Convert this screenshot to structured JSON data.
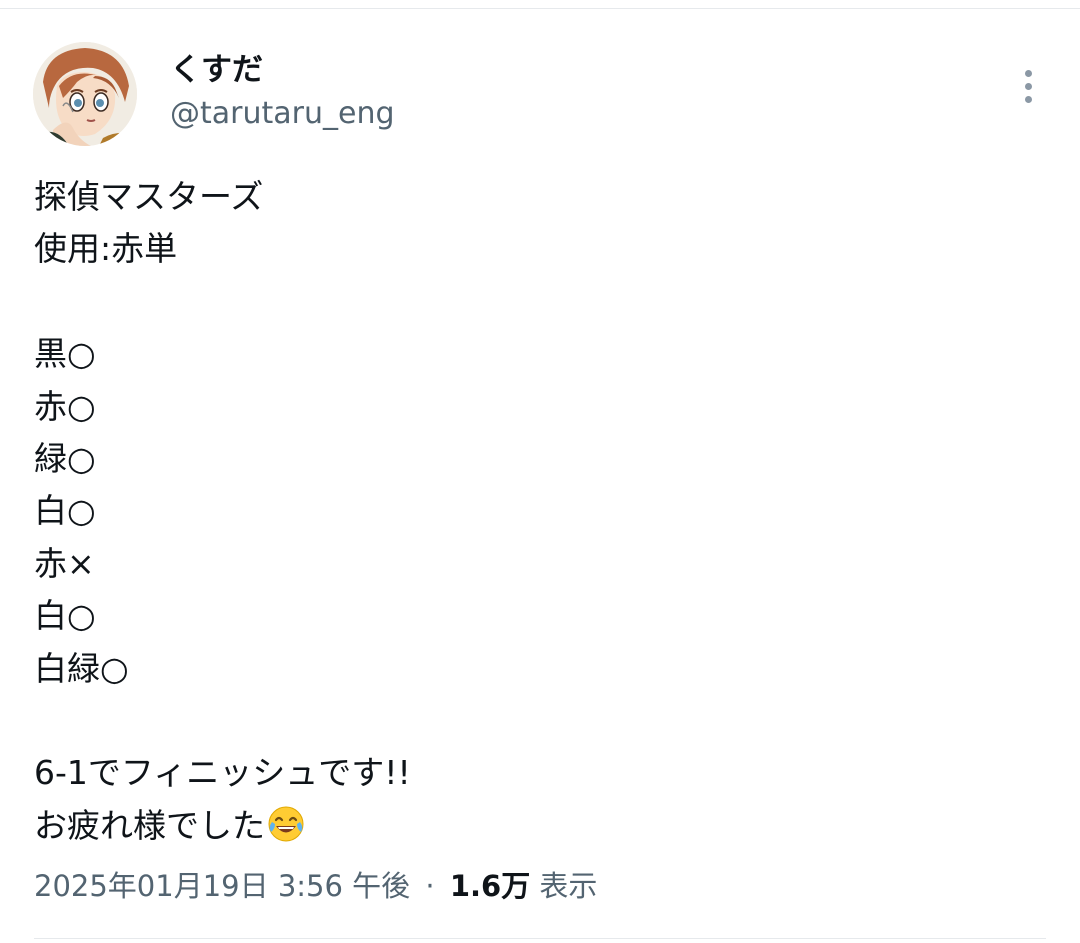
{
  "author": {
    "display_name": "くすだ",
    "handle": "@tarutaru_eng",
    "avatar_icon": "anime-character-avatar"
  },
  "menu": {
    "icon": "more-vertical-icon"
  },
  "tweet": {
    "lines": [
      "探偵マスターズ",
      "使用:赤単",
      "",
      "黒○",
      "赤○",
      "緑○",
      "白○",
      "赤×",
      "白○",
      "白緑○",
      "",
      "6-1でフィニッシュです!!",
      "お疲れ様でした"
    ],
    "trailing_emoji": "😂"
  },
  "meta": {
    "timestamp": "2025年01月19日 3:56 午後",
    "separator": "·",
    "views_count": "1.6万",
    "views_label": "表示"
  },
  "colors": {
    "text_primary": "#0f1419",
    "text_secondary": "#536471",
    "divider": "#e6e9ec",
    "menu_dots": "#8b98a5"
  }
}
